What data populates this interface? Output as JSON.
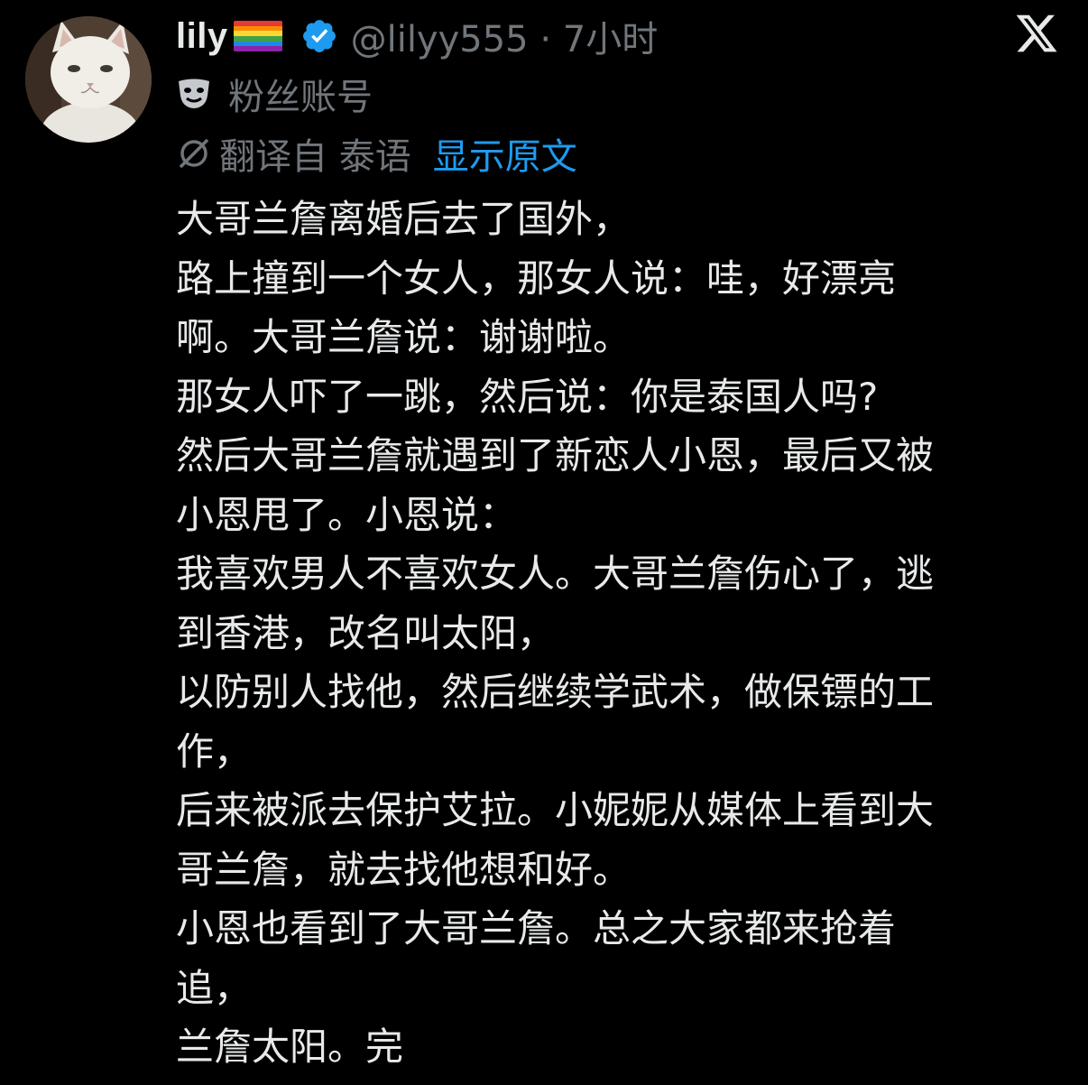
{
  "author": {
    "display_name": "lily",
    "handle_time": "@lilyy555 · 7小时",
    "account_label": "粉丝账号"
  },
  "translation": {
    "translated_from": "翻译自 泰语",
    "show_original": "显示原文"
  },
  "tweet": {
    "lines": [
      "大哥兰詹离婚后去了国外，",
      "路上撞到一个女人，那女人说：哇，好漂亮",
      "啊。大哥兰詹说：谢谢啦。",
      "那女人吓了一跳，然后说：你是泰国人吗?",
      "然后大哥兰詹就遇到了新恋人小恩，最后又被",
      "小恩甩了。小恩说：",
      "我喜欢男人不喜欢女人。大哥兰詹伤心了，逃",
      "到香港，改名叫太阳，",
      "以防别人找他，然后继续学武术，做保镖的工",
      "作，",
      "后来被派去保护艾拉。小妮妮从媒体上看到大",
      "哥兰詹，就去找他想和好。",
      "小恩也看到了大哥兰詹。总之大家都来抢着",
      "追，",
      "兰詹太阳。完"
    ]
  },
  "icons": {
    "avatar": "white-cat-photo",
    "flag": "rainbow-flag-icon",
    "verified": "verified-badge-icon",
    "fan_account": "theater-mask-icon",
    "translate": "no-symbol-icon",
    "brand": "x-logo-icon"
  },
  "colors": {
    "background": "#000000",
    "text_primary": "#e7e9ea",
    "text_secondary": "#71767b",
    "link": "#1d9bf0",
    "verified": "#1d9bf0"
  }
}
